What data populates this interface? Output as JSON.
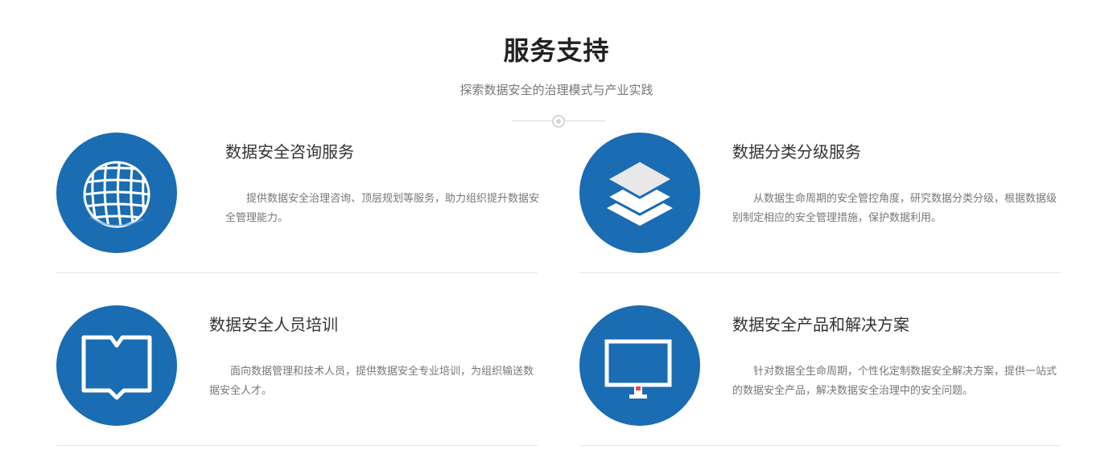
{
  "header": {
    "title": "服务支持",
    "subtitle": "探索数据安全的治理模式与产业实践"
  },
  "colors": {
    "accent_circle": "#1a6cb3",
    "title_text": "#222222",
    "desc_text": "#777777"
  },
  "services": [
    {
      "icon": "globe-icon",
      "title": "数据安全咨询服务",
      "description": "提供数据安全治理咨询、顶层规划等服务，助力组织提升数据安全管理能力。"
    },
    {
      "icon": "layers-icon",
      "title": "数据分类分级服务",
      "description": "从数据生命周期的安全管控角度，研究数据分类分级，根据数据级别制定相应的安全管理措施，保护数据利用。"
    },
    {
      "icon": "book-icon",
      "title": "数据安全人员培训",
      "description": "面向数据管理和技术人员，提供数据安全专业培训，为组织输送数据安全人才。"
    },
    {
      "icon": "monitor-icon",
      "title": "数据安全产品和解决方案",
      "description": "针对数据全生命周期，个性化定制数据安全解决方案，提供一站式的数据安全产品，解决数据安全治理中的安全问题。"
    }
  ]
}
